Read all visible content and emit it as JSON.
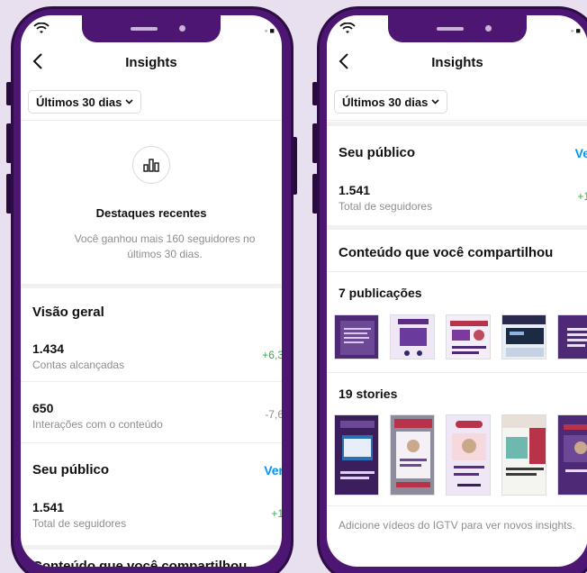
{
  "colors": {
    "frame": "#4d1673",
    "background": "#e9e0ef",
    "positive": "#3aaa4a",
    "link": "#0095f6"
  },
  "status": {
    "right": "◦ ■"
  },
  "left_screen": {
    "title": "Insights",
    "range": "Últimos 30 dias",
    "highlights": {
      "title": "Destaques recentes",
      "line1": "Você ganhou mais 160 seguidores no",
      "line2": "últimos 30 dias."
    },
    "overview": {
      "title": "Visão geral",
      "metrics": [
        {
          "value": "1.434",
          "label": "Contas alcançadas",
          "delta": "+6,3"
        },
        {
          "value": "650",
          "label": "Interações com o conteúdo",
          "delta": "-7,6"
        }
      ]
    },
    "audience": {
      "title": "Seu público",
      "link": "Ver",
      "value": "1.541",
      "label": "Total de seguidores",
      "delta": "+1"
    },
    "shared_title_partial": "Conteúdo que você compartilhou"
  },
  "right_screen": {
    "title": "Insights",
    "range": "Últimos 30 dias",
    "audience": {
      "title": "Seu público",
      "link": "Ve",
      "value": "1.541",
      "label": "Total de seguidores",
      "delta": "+1"
    },
    "shared": {
      "title": "Conteúdo que você compartilhou",
      "posts_title": "7 publicações",
      "stories_title": "19 stories"
    },
    "footer": "Adicione vídeos do IGTV para ver novos insights."
  }
}
